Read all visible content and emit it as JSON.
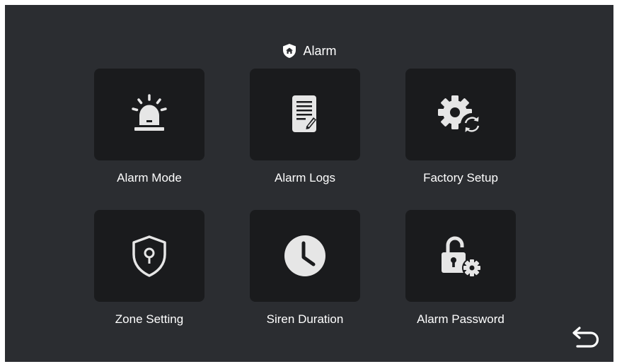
{
  "header": {
    "title": "Alarm",
    "icon": "home-shield-icon"
  },
  "tiles": [
    {
      "label": "Alarm Mode",
      "icon": "siren-icon"
    },
    {
      "label": "Alarm Logs",
      "icon": "document-edit-icon"
    },
    {
      "label": "Factory Setup",
      "icon": "gear-refresh-icon"
    },
    {
      "label": "Zone Setting",
      "icon": "shield-keyhole-icon"
    },
    {
      "label": "Siren Duration",
      "icon": "clock-icon"
    },
    {
      "label": "Alarm Password",
      "icon": "lock-gear-icon"
    }
  ],
  "footer": {
    "back_icon": "back-arrow-icon"
  },
  "colors": {
    "background": "#2b2d31",
    "tile": "#1a1b1d",
    "icon": "#e6e6e6",
    "text": "#ffffff"
  }
}
